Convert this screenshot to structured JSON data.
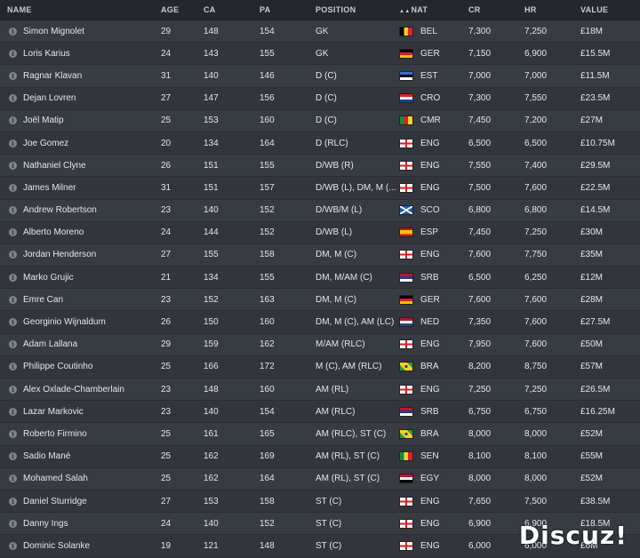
{
  "header": {
    "name": "NAME",
    "age": "AGE",
    "ca": "CA",
    "pa": "PA",
    "position": "POSITION",
    "nat": "NAT",
    "cr": "CR",
    "hr": "HR",
    "value": "VALUE"
  },
  "players": [
    {
      "name": "Simon Mignolet",
      "age": "29",
      "ca": "148",
      "pa": "154",
      "position": "GK",
      "nat": "BEL",
      "cr": "7,300",
      "hr": "7,250",
      "value": "£18M"
    },
    {
      "name": "Loris Karius",
      "age": "24",
      "ca": "143",
      "pa": "155",
      "position": "GK",
      "nat": "GER",
      "cr": "7,150",
      "hr": "6,900",
      "value": "£15.5M"
    },
    {
      "name": "Ragnar Klavan",
      "age": "31",
      "ca": "140",
      "pa": "146",
      "position": "D (C)",
      "nat": "EST",
      "cr": "7,000",
      "hr": "7,000",
      "value": "£11.5M"
    },
    {
      "name": "Dejan Lovren",
      "age": "27",
      "ca": "147",
      "pa": "156",
      "position": "D (C)",
      "nat": "CRO",
      "cr": "7,300",
      "hr": "7,550",
      "value": "£23.5M"
    },
    {
      "name": "Joël Matip",
      "age": "25",
      "ca": "153",
      "pa": "160",
      "position": "D (C)",
      "nat": "CMR",
      "cr": "7,450",
      "hr": "7,200",
      "value": "£27M"
    },
    {
      "name": "Joe Gomez",
      "age": "20",
      "ca": "134",
      "pa": "164",
      "position": "D (RLC)",
      "nat": "ENG",
      "cr": "6,500",
      "hr": "6,500",
      "value": "£10.75M"
    },
    {
      "name": "Nathaniel Clyne",
      "age": "26",
      "ca": "151",
      "pa": "155",
      "position": "D/WB (R)",
      "nat": "ENG",
      "cr": "7,550",
      "hr": "7,400",
      "value": "£29.5M"
    },
    {
      "name": "James Milner",
      "age": "31",
      "ca": "151",
      "pa": "157",
      "position": "D/WB (L), DM, M (...",
      "nat": "ENG",
      "cr": "7,500",
      "hr": "7,600",
      "value": "£22.5M"
    },
    {
      "name": "Andrew Robertson",
      "age": "23",
      "ca": "140",
      "pa": "152",
      "position": "D/WB/M (L)",
      "nat": "SCO",
      "cr": "6,800",
      "hr": "6,800",
      "value": "£14.5M"
    },
    {
      "name": "Alberto Moreno",
      "age": "24",
      "ca": "144",
      "pa": "152",
      "position": "D/WB (L)",
      "nat": "ESP",
      "cr": "7,450",
      "hr": "7,250",
      "value": "£30M"
    },
    {
      "name": "Jordan Henderson",
      "age": "27",
      "ca": "155",
      "pa": "158",
      "position": "DM, M (C)",
      "nat": "ENG",
      "cr": "7,600",
      "hr": "7,750",
      "value": "£35M"
    },
    {
      "name": "Marko Grujic",
      "age": "21",
      "ca": "134",
      "pa": "155",
      "position": "DM, M/AM (C)",
      "nat": "SRB",
      "cr": "6,500",
      "hr": "6,250",
      "value": "£12M"
    },
    {
      "name": "Emre Can",
      "age": "23",
      "ca": "152",
      "pa": "163",
      "position": "DM, M (C)",
      "nat": "GER",
      "cr": "7,600",
      "hr": "7,600",
      "value": "£28M"
    },
    {
      "name": "Georginio Wijnaldum",
      "age": "26",
      "ca": "150",
      "pa": "160",
      "position": "DM, M (C), AM (LC)",
      "nat": "NED",
      "cr": "7,350",
      "hr": "7,600",
      "value": "£27.5M"
    },
    {
      "name": "Adam Lallana",
      "age": "29",
      "ca": "159",
      "pa": "162",
      "position": "M/AM (RLC)",
      "nat": "ENG",
      "cr": "7,950",
      "hr": "7,600",
      "value": "£50M"
    },
    {
      "name": "Philippe Coutinho",
      "age": "25",
      "ca": "166",
      "pa": "172",
      "position": "M (C), AM (RLC)",
      "nat": "BRA",
      "cr": "8,200",
      "hr": "8,750",
      "value": "£57M"
    },
    {
      "name": "Alex Oxlade-Chamberlain",
      "age": "23",
      "ca": "148",
      "pa": "160",
      "position": "AM (RL)",
      "nat": "ENG",
      "cr": "7,250",
      "hr": "7,250",
      "value": "£26.5M"
    },
    {
      "name": "Lazar Markovic",
      "age": "23",
      "ca": "140",
      "pa": "154",
      "position": "AM (RLC)",
      "nat": "SRB",
      "cr": "6,750",
      "hr": "6,750",
      "value": "£16.25M"
    },
    {
      "name": "Roberto Firmino",
      "age": "25",
      "ca": "161",
      "pa": "165",
      "position": "AM (RLC), ST (C)",
      "nat": "BRA",
      "cr": "8,000",
      "hr": "8,000",
      "value": "£52M"
    },
    {
      "name": "Sadio Mané",
      "age": "25",
      "ca": "162",
      "pa": "169",
      "position": "AM (RL), ST (C)",
      "nat": "SEN",
      "cr": "8,100",
      "hr": "8,100",
      "value": "£55M"
    },
    {
      "name": "Mohamed Salah",
      "age": "25",
      "ca": "162",
      "pa": "164",
      "position": "AM (RL), ST (C)",
      "nat": "EGY",
      "cr": "8,000",
      "hr": "8,000",
      "value": "£52M"
    },
    {
      "name": "Daniel Sturridge",
      "age": "27",
      "ca": "153",
      "pa": "158",
      "position": "ST (C)",
      "nat": "ENG",
      "cr": "7,650",
      "hr": "7,500",
      "value": "£38.5M"
    },
    {
      "name": "Danny Ings",
      "age": "24",
      "ca": "140",
      "pa": "152",
      "position": "ST (C)",
      "nat": "ENG",
      "cr": "6,900",
      "hr": "6,900",
      "value": "£18.5M"
    },
    {
      "name": "Dominic Solanke",
      "age": "19",
      "ca": "121",
      "pa": "148",
      "position": "ST (C)",
      "nat": "ENG",
      "cr": "6,000",
      "hr": "6,000",
      "value": "£6M"
    }
  ],
  "watermark": "Discuz!"
}
